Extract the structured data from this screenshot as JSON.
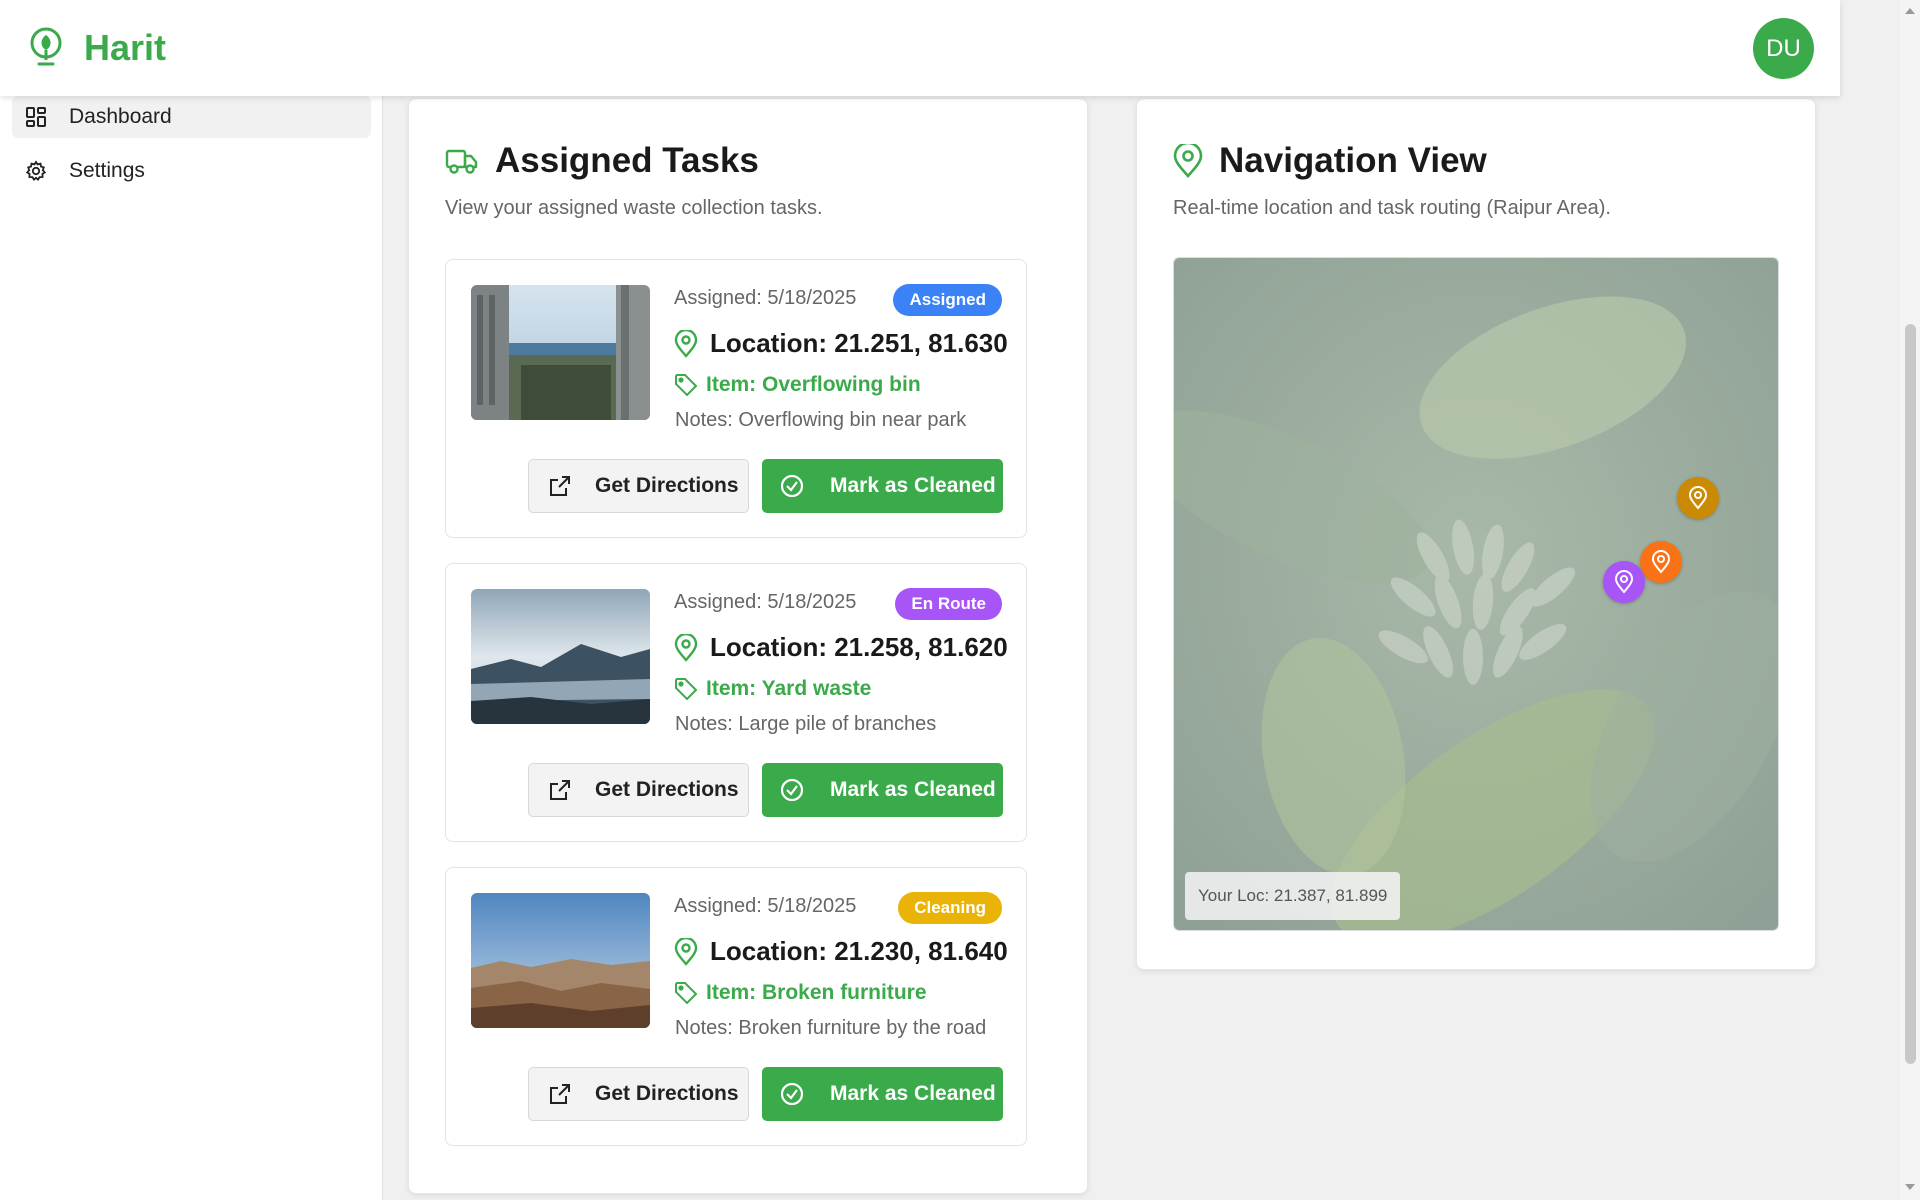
{
  "app": {
    "name": "Harit",
    "user_initials": "DU"
  },
  "sidebar": {
    "items": [
      {
        "label": "Dashboard",
        "icon": "dashboard-grid-icon",
        "active": true
      },
      {
        "label": "Settings",
        "icon": "gear-icon",
        "active": false
      }
    ]
  },
  "tasks_panel": {
    "title": "Assigned Tasks",
    "icon": "truck-icon",
    "subtitle": "View your assigned waste collection tasks.",
    "tasks": [
      {
        "assigned": "Assigned: 5/18/2025",
        "status": "Assigned",
        "status_color": "#3b82f6",
        "location": "Location: 21.251, 81.630",
        "item": "Item: Overflowing bin",
        "notes": "Notes: Overflowing bin near park",
        "photo": "coastal city view between buildings"
      },
      {
        "assigned": "Assigned: 5/18/2025",
        "status": "En Route",
        "status_color": "#a855f7",
        "location": "Location: 21.258, 81.620",
        "item": "Item: Yard waste",
        "notes": "Notes: Large pile of branches",
        "photo": "misty mountain valley"
      },
      {
        "assigned": "Assigned: 5/18/2025",
        "status": "Cleaning",
        "status_color": "#eab308",
        "location": "Location: 21.230, 81.640",
        "item": "Item: Broken furniture",
        "notes": "Notes: Broken furniture by the road",
        "photo": "desert hills under blue sky"
      }
    ],
    "directions_label": "Get Directions",
    "clean_label": "Mark as Cleaned"
  },
  "nav_panel": {
    "title": "Navigation View",
    "icon": "map-pin-icon",
    "subtitle": "Real-time location and task routing (Raipur Area).",
    "your_location": "Your Loc: 21.387, 81.899",
    "pin_colors": {
      "assigned": "#ca8a04",
      "cleaning": "#f97316",
      "en_route": "#a855f7"
    }
  },
  "colors": {
    "brand": "#3aaa4a",
    "header_bg": "#ffffff",
    "page_bg": "#f0f0f0"
  }
}
